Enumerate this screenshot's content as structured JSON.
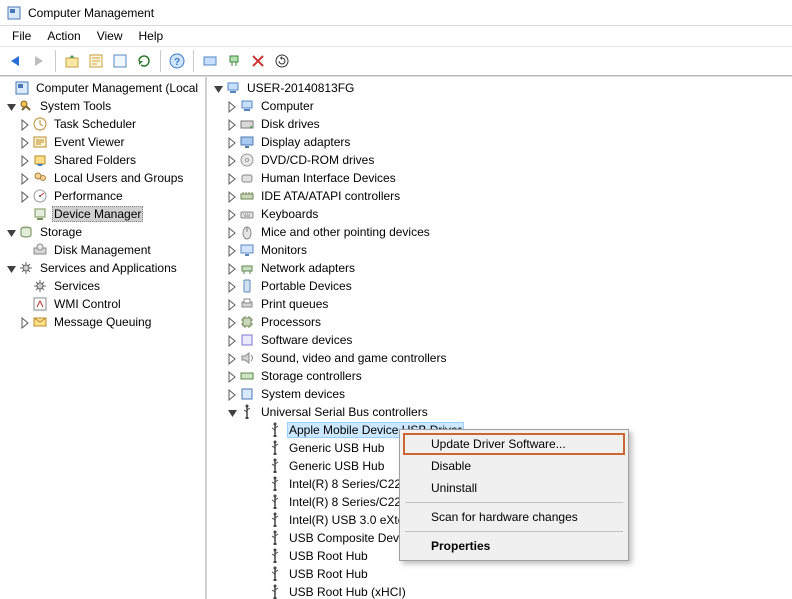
{
  "window": {
    "title": "Computer Management"
  },
  "menu": {
    "file": "File",
    "action": "Action",
    "view": "View",
    "help": "Help"
  },
  "leftTree": {
    "root": "Computer Management (Local",
    "systemTools": "System Tools",
    "taskScheduler": "Task Scheduler",
    "eventViewer": "Event Viewer",
    "sharedFolders": "Shared Folders",
    "localUsers": "Local Users and Groups",
    "performance": "Performance",
    "deviceManager": "Device Manager",
    "storage": "Storage",
    "diskManagement": "Disk Management",
    "services": "Services and Applications",
    "servicesNode": "Services",
    "wmi": "WMI Control",
    "msmq": "Message Queuing"
  },
  "rightTree": {
    "root": "USER-20140813FG",
    "computer": "Computer",
    "diskDrives": "Disk drives",
    "displayAdapters": "Display adapters",
    "dvd": "DVD/CD-ROM drives",
    "hid": "Human Interface Devices",
    "ide": "IDE ATA/ATAPI controllers",
    "keyboards": "Keyboards",
    "mice": "Mice and other pointing devices",
    "monitors": "Monitors",
    "networkAdapters": "Network adapters",
    "portableDevices": "Portable Devices",
    "printQueues": "Print queues",
    "processors": "Processors",
    "softwareDevices": "Software devices",
    "sound": "Sound, video and game controllers",
    "storageCtrl": "Storage controllers",
    "systemDevices": "System devices",
    "usb": "Universal Serial Bus controllers",
    "apple": "Apple Mobile Device USB Driver",
    "genericHub1": "Generic USB Hub",
    "genericHub2": "Generic USB Hub",
    "intel1": "Intel(R) 8 Series/C220",
    "intel2": "Intel(R) 8 Series/C220",
    "intelUsb3": "Intel(R) USB 3.0 eXten",
    "usbComposite": "USB Composite Devic",
    "usbRootHub1": "USB Root Hub",
    "usbRootHub2": "USB Root Hub",
    "usbRootHubXhci": "USB Root Hub (xHCI)"
  },
  "context": {
    "update": "Update Driver Software...",
    "disable": "Disable",
    "uninstall": "Uninstall",
    "scan": "Scan for hardware changes",
    "properties": "Properties"
  }
}
